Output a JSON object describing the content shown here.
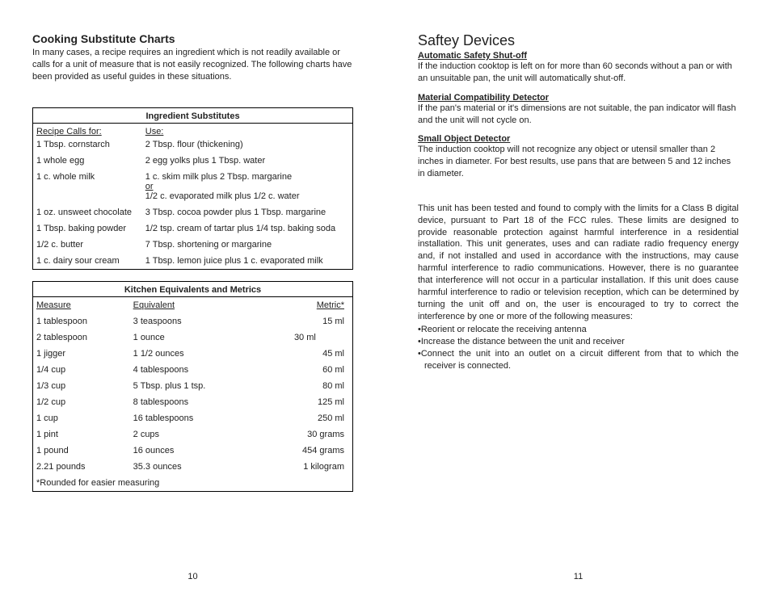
{
  "left": {
    "title": "Cooking Substitute Charts",
    "intro": "In many cases, a recipe requires an ingredient which is not readily available or calls for a unit of measure that is not easily recognized. The following charts have been provided as useful guides in these situations.",
    "ingredients": {
      "caption": "Ingredient Substitutes",
      "col1": "Recipe Calls for:",
      "col2": "Use:",
      "rows": [
        {
          "a": "1 Tbsp. cornstarch",
          "b": "2 Tbsp. flour (thickening)"
        },
        {
          "a": "1 whole egg",
          "b": "2 egg yolks plus 1 Tbsp. water"
        },
        {
          "a": "1 c. whole milk",
          "b": "1 c. skim milk plus 2 Tbsp. margarine",
          "or": "or",
          "b2": "1/2 c. evaporated milk plus 1/2 c. water"
        },
        {
          "a": "1 oz. unsweet chocolate",
          "b": "3 Tbsp. cocoa powder plus 1 Tbsp. margarine"
        },
        {
          "a": "1 Tbsp. baking powder",
          "b": "1/2 tsp. cream of tartar plus 1/4 tsp. baking soda"
        },
        {
          "a": "1/2 c. butter",
          "b": "7 Tbsp. shortening or margarine"
        },
        {
          "a": "1 c. dairy sour cream",
          "b": "1 Tbsp. lemon juice plus 1 c. evaporated milk"
        }
      ]
    },
    "metrics": {
      "caption": "Kitchen Equivalents and Metrics",
      "col1": "Measure",
      "col2": "Equivalent",
      "col3": "Metric*",
      "rows": [
        {
          "a": "1 tablespoon",
          "b": "3 teaspoons",
          "c": "15 ml"
        },
        {
          "a": "2 tablespoon",
          "b": "1 ounce",
          "c": "30 ml"
        },
        {
          "a": "1 jigger",
          "b": "1 1/2 ounces",
          "c": "45 ml"
        },
        {
          "a": "1/4 cup",
          "b": "4 tablespoons",
          "c": "60 ml"
        },
        {
          "a": "1/3 cup",
          "b": "5 Tbsp. plus 1 tsp.",
          "c": "80 ml"
        },
        {
          "a": "1/2 cup",
          "b": "8 tablespoons",
          "c": "125 ml"
        },
        {
          "a": "1 cup",
          "b": "16 tablespoons",
          "c": "250 ml"
        },
        {
          "a": "1 pint",
          "b": "2 cups",
          "c": "30 grams"
        },
        {
          "a": "1 pound",
          "b": "16 ounces",
          "c": "454 grams"
        },
        {
          "a": "2.21 pounds",
          "b": "35.3 ounces",
          "c": "1 kilogram"
        }
      ],
      "note": "*Rounded for easier measuring"
    },
    "pageNum": "10"
  },
  "right": {
    "title": "Saftey Devices",
    "sections": [
      {
        "h": "Automatic Safety Shut-off",
        "p": "If the induction cooktop is left on for more than 60 seconds without a pan or with an unsuitable pan, the unit will automatically shut-off."
      },
      {
        "h": "Material Compatibility Detector",
        "p": "If the pan's material or it's dimensions are not suitable, the pan indicator will flash and the unit will not cycle on."
      },
      {
        "h": "Small Object Detector",
        "p": "The induction cooktop will not recognize any object or utensil smaller than 2 inches in diameter. For best results, use pans that are between 5 and 12 inches in diameter."
      }
    ],
    "fcc": "This unit has been tested and found to comply with the limits for a Class B digital device, pursuant to Part 18 of the FCC rules. These limits are designed to provide reasonable protection against harmful interference in a residential installation. This unit generates, uses and can radiate radio frequency energy and, if not installed and used in accordance with the instructions, may cause harmful interference to radio communications. However, there is no guarantee that interference will not occur in a particular installation. If this unit does cause harmful interference to radio or television reception, which can be determined by turning the unit off and on, the user is encouraged to try to correct the interference by one or more of the following measures:",
    "bullets": [
      "Reorient or relocate the receiving antenna",
      "Increase the distance between the unit and receiver",
      "Connect the unit into an outlet on a circuit different from that to which the receiver is connected."
    ],
    "pageNum": "11"
  }
}
